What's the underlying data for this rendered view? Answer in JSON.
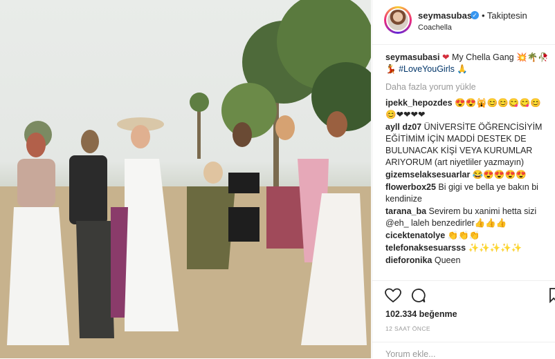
{
  "post": {
    "image_alt": "",
    "username": "seymasubasi",
    "follow_label": "• Takiptesin",
    "location": "Coachella",
    "caption_user": "seymasubasi",
    "caption_text": "My Chella Gang 💥🌴🥀",
    "caption_line2": "💃",
    "caption_hashtag": "#LoveYouGirls",
    "caption_end": "🙏",
    "load_more": "Daha fazla yorum yükle",
    "likes": "102.334 beğenme",
    "timestamp": "12 SAAT ÖNCE",
    "comment_placeholder": "Yorum ekle..."
  },
  "comments": [
    {
      "user": "ipekk_hepozdes",
      "text": "😍😍🙀😊😊😋😋😊😊❤❤❤❤"
    },
    {
      "user": "ayll dz07",
      "text": "ÜNİVERSİTE ÖĞRENCİSİYİM EĞİTİMİM İÇİN MADDİ DESTEK DE BULUNACAK KİŞİ VEYA KURUMLAR ARIYORUM (art niyetliler yazmayın)"
    },
    {
      "user": "gizemselaksesuarlar",
      "text": "😂😍😍😍😍"
    },
    {
      "user": "flowerbox25",
      "text": "Bi gigi ve bella ye bakın bi kendinize"
    },
    {
      "user": "tarana_ba",
      "text": "Sevirem bu xanimi hetta sizi @eh_ laleh benzedirler👍👍👍"
    },
    {
      "user": "cicektenatolye",
      "text": "👏👏👏"
    },
    {
      "user": "telefonaksesuarsss",
      "text": "✨✨✨✨✨"
    },
    {
      "user": "dieforonika",
      "text": "Queen"
    }
  ],
  "icons": [
    "heart-icon",
    "comment-icon",
    "bookmark-icon",
    "verified-icon"
  ],
  "colors": {
    "link": "#003569",
    "verified": "#3897f0",
    "muted": "#999999"
  }
}
